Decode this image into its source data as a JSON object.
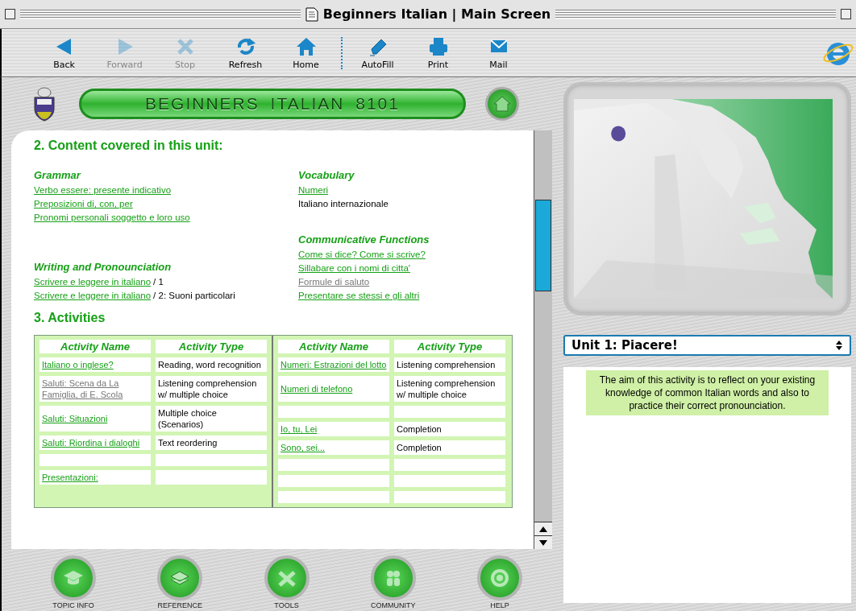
{
  "window": {
    "title": "Beginners Italian | Main Screen"
  },
  "toolbar": [
    {
      "label": "Back",
      "kind": "back",
      "disabled": false
    },
    {
      "label": "Forward",
      "kind": "forward",
      "disabled": true
    },
    {
      "label": "Stop",
      "kind": "stop",
      "disabled": true
    },
    {
      "label": "Refresh",
      "kind": "refresh",
      "disabled": false
    },
    {
      "label": "Home",
      "kind": "home",
      "disabled": false
    },
    {
      "label": "AutoFill",
      "kind": "autofill",
      "disabled": false
    },
    {
      "label": "Print",
      "kind": "print",
      "disabled": false
    },
    {
      "label": "Mail",
      "kind": "mail",
      "disabled": false
    }
  ],
  "banner": {
    "title": "BEGINNERS ITALIAN 8101"
  },
  "content": {
    "heading": "2. Content covered in this unit:",
    "columns": [
      {
        "sections": [
          {
            "title": "Grammar",
            "items": [
              {
                "kind": "link",
                "text": "Verbo essere: presente indicativo",
                "visited": false
              },
              {
                "kind": "link",
                "text": "Preposizioni di, con, per",
                "visited": false
              },
              {
                "kind": "link",
                "text": "Pronomi personali soggetto e loro uso",
                "visited": false
              }
            ]
          },
          {
            "title": "Writing and Pronounciation",
            "items": [
              {
                "kind": "link",
                "text": "Scrivere e leggere in italiano",
                "after": "/ 1",
                "visited": false
              },
              {
                "kind": "link",
                "text": "Scrivere e leggere in italiano",
                "after": "/ 2: Suoni particolari",
                "visited": false
              }
            ]
          }
        ]
      },
      {
        "sections": [
          {
            "title": "Vocabulary",
            "items": [
              {
                "kind": "link",
                "text": "Numeri",
                "visited": false
              },
              {
                "kind": "text",
                "text": "Italiano internazionale"
              }
            ]
          },
          {
            "title": "Communicative Functions",
            "items": [
              {
                "kind": "link",
                "text": "Come si dice? Come si scrive?",
                "visited": false
              },
              {
                "kind": "link",
                "text": "Sillabare con i nomi di citta'",
                "visited": false
              },
              {
                "kind": "link",
                "text": "Formule di saluto",
                "visited": true
              },
              {
                "kind": "link",
                "text": "Presentare se stessi e gli altri",
                "visited": false
              }
            ]
          }
        ]
      }
    ],
    "activities_heading": "3. Activities"
  },
  "table": {
    "halves": [
      {
        "columns": [
          "Activity Name",
          "Activity Type"
        ],
        "rows": [
          {
            "kind": "activity",
            "name": "Italiano o inglese?",
            "type": "Reading, word recognition",
            "visited": false
          },
          {
            "kind": "activity",
            "name": "Saluti: Scena da La Famiglia, di E. Scola",
            "type": "Listening comprehension w/ multiple choice",
            "visited": true
          },
          {
            "kind": "activity",
            "name": "Saluti: Situazioni",
            "type": "Multiple choice (Scenarios)",
            "visited": false
          },
          {
            "kind": "activity",
            "name": "Saluti: Riordina i dialoghi",
            "type": "Text reordering",
            "visited": false
          },
          {
            "kind": "empty"
          },
          {
            "kind": "activity",
            "name": "Presentazioni:",
            "visited": false
          }
        ]
      },
      {
        "columns": [
          "Activity Name",
          "Activity Type"
        ],
        "rows": [
          {
            "kind": "activity",
            "name": "Numeri: Estrazioni del lotto",
            "type": "Listening comprehension",
            "visited": false
          },
          {
            "kind": "activity",
            "name": "Numeri di telefono",
            "type": "Listening comprehension w/ multiple choice",
            "visited": false
          },
          {
            "kind": "empty"
          },
          {
            "kind": "activity",
            "name": "Io, tu, Lei",
            "type": "Completion",
            "visited": false
          },
          {
            "kind": "activity",
            "name": "Sono, sei...",
            "type": "Completion",
            "visited": false
          },
          {
            "kind": "empty"
          },
          {
            "kind": "empty"
          },
          {
            "kind": "empty"
          }
        ]
      }
    ]
  },
  "nav": [
    {
      "label": "TOPIC INFO",
      "kind": "topic"
    },
    {
      "label": "REFERENCE",
      "kind": "reference"
    },
    {
      "label": "TOOLS",
      "kind": "tools"
    },
    {
      "label": "COMMUNITY",
      "kind": "community"
    },
    {
      "label": "HELP",
      "kind": "help"
    }
  ],
  "unit_select": {
    "value": "Unit 1: Piacere!"
  },
  "description": "The aim of this activity is to reflect on your existing knowledge of common Italian words and also to practice their correct pronounciation."
}
